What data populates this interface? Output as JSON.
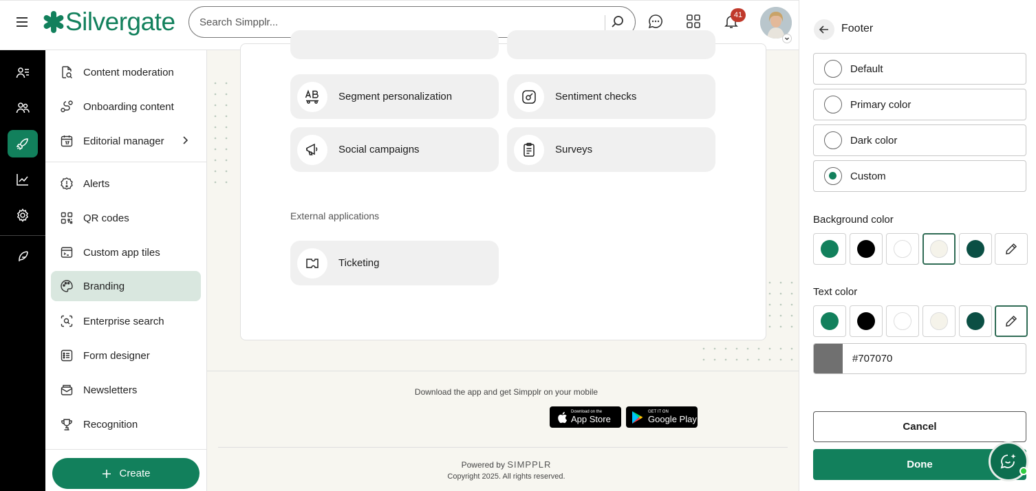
{
  "header": {
    "brand": "Silvergate",
    "search_placeholder": "Search Simpplr...",
    "notification_count": "41"
  },
  "sidebar": {
    "items": [
      {
        "label": "Content moderation"
      },
      {
        "label": "Onboarding content"
      },
      {
        "label": "Editorial manager"
      },
      {
        "label": "Alerts"
      },
      {
        "label": "QR codes"
      },
      {
        "label": "Custom app tiles"
      },
      {
        "label": "Branding",
        "active": true
      },
      {
        "label": "Enterprise search"
      },
      {
        "label": "Form designer"
      },
      {
        "label": "Newsletters"
      },
      {
        "label": "Recognition"
      }
    ],
    "create_label": "Create"
  },
  "main": {
    "tiles": [
      {
        "label": "Segment personalization",
        "icon": "ab-text-icon"
      },
      {
        "label": "Sentiment checks",
        "icon": "gauge-icon"
      },
      {
        "label": "Social campaigns",
        "icon": "megaphone-icon"
      },
      {
        "label": "Surveys",
        "icon": "clipboard-icon"
      }
    ],
    "external_label": "External applications",
    "external_tiles": [
      {
        "label": "Ticketing",
        "icon": "ticket-icon"
      }
    ],
    "footer": {
      "download_text": "Download the app and get Simpplr on your mobile",
      "appstore_small": "Download on the",
      "appstore_big": "App Store",
      "googleplay_small": "GET IT ON",
      "googleplay_big": "Google Play",
      "powered_by": "Powered by",
      "powered_brand": "SIMPPLR",
      "copyright": "Copyright 2025. All rights reserved."
    }
  },
  "panel": {
    "title": "Footer",
    "options": [
      {
        "label": "Default",
        "selected": false
      },
      {
        "label": "Primary color",
        "selected": false
      },
      {
        "label": "Dark color",
        "selected": false
      },
      {
        "label": "Custom",
        "selected": true
      }
    ],
    "background_label": "Background color",
    "text_label": "Text color",
    "swatches": [
      "#12805c",
      "#000000",
      "#ffffff",
      "#f5f3ea",
      "#0b4f44"
    ],
    "hex_value": "#707070",
    "cancel_label": "Cancel",
    "done_label": "Done"
  },
  "colors": {
    "accent": "#12805c",
    "active_nav": "#d9e7df",
    "badge": "#c0392b"
  }
}
